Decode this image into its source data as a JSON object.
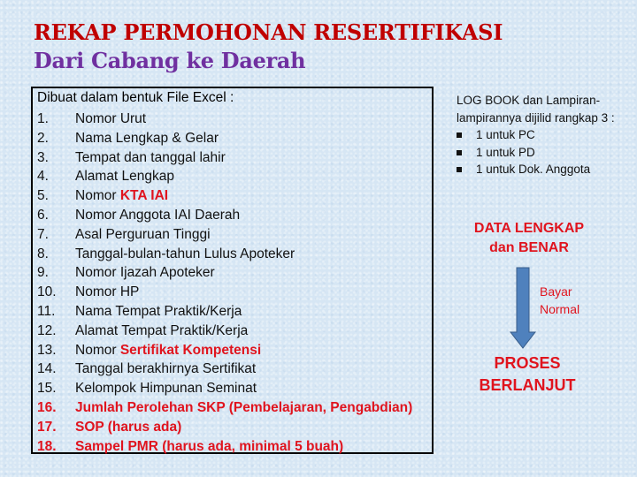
{
  "title": {
    "line1": "REKAP PERMOHONAN RESERTIFIKASI",
    "line2": "Dari Cabang ke Daerah",
    "line1_color": "#c00000",
    "line2_color": "#7030a0"
  },
  "requirements_box": {
    "header": "Dibuat dalam bentuk File Excel :",
    "items": [
      {
        "num": "1.",
        "text": "Nomor Urut"
      },
      {
        "num": "2.",
        "text": "Nama Lengkap & Gelar"
      },
      {
        "num": "3.",
        "text": "Tempat dan tanggal lahir"
      },
      {
        "num": "4.",
        "text": "Alamat Lengkap"
      },
      {
        "num": "5.",
        "text": "Nomor ",
        "highlight": "KTA IAI"
      },
      {
        "num": "6.",
        "text": "Nomor Anggota IAI Daerah"
      },
      {
        "num": "7.",
        "text": "Asal Perguruan Tinggi"
      },
      {
        "num": "8.",
        "text": "Tanggal-bulan-tahun Lulus Apoteker"
      },
      {
        "num": "9.",
        "text": "Nomor Ijazah Apoteker"
      },
      {
        "num": "10.",
        "text": "Nomor HP"
      },
      {
        "num": "11.",
        "text": "Nama Tempat Praktik/Kerja"
      },
      {
        "num": "12.",
        "text": "Alamat Tempat Praktik/Kerja"
      },
      {
        "num": "13.",
        "text": "Nomor ",
        "highlight": "Sertifikat Kompetensi"
      },
      {
        "num": "14.",
        "text": "Tanggal berakhirnya Sertifikat"
      },
      {
        "num": "15.",
        "text": "Kelompok Himpunan Seminat"
      },
      {
        "num": "16.",
        "text": "Jumlah Perolehan SKP (Pembelajaran, Pengabdian)",
        "all_red": true
      },
      {
        "num": "17.",
        "text": "SOP (harus ada)",
        "all_red": true
      },
      {
        "num": "18.",
        "text": "Sampel PMR (harus ada, minimal 5 buah)",
        "all_red": true
      }
    ]
  },
  "logbook": {
    "intro": "LOG BOOK dan Lampiran-lampirannya dijilid rangkap 3 :",
    "bullets": [
      "1 untuk PC",
      "1 untuk PD",
      "1 untuk Dok. Anggota"
    ]
  },
  "flow": {
    "status": [
      "DATA LENGKAP",
      "dan BENAR"
    ],
    "arrow_label": [
      "Bayar",
      "Normal"
    ],
    "result": [
      "PROSES",
      "BERLANJUT"
    ],
    "arrow_color": "#4f81bd",
    "accent_color": "#e0141e"
  }
}
